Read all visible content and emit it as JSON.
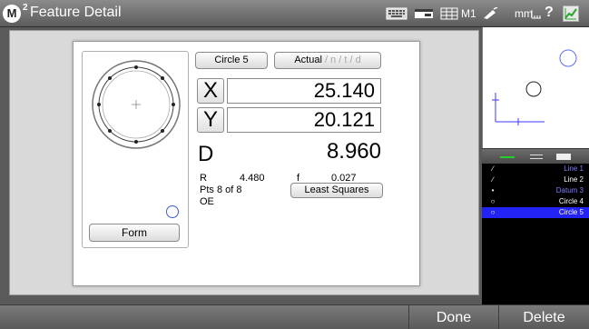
{
  "app": {
    "logo_letter": "M",
    "logo_sup": "2",
    "title": "Feature Detail"
  },
  "toolbar": {
    "icons": [
      "keyboard-icon",
      "display-icon",
      "grid-icon",
      "probe-icon",
      "ruler-icon",
      "help-icon",
      "graph-icon"
    ],
    "machine": "M1",
    "units": "mm",
    "help": "?"
  },
  "feature": {
    "name": "Circle 5",
    "mode_label": "Actual",
    "mode_suffix": " / n / t / d",
    "x_label": "X",
    "x_value": "25.140",
    "y_label": "Y",
    "y_value": "20.121",
    "d_label": "D",
    "d_value": "8.960",
    "r_label": "R",
    "r_value": "4.480",
    "f_label": "f",
    "f_value": "0.027",
    "pts_text": "Pts 8 of 8",
    "oe_text": "OE",
    "fit_method": "Least Squares",
    "form_button": "Form"
  },
  "feature_list": [
    {
      "icon": "line-icon",
      "name": "Line 1",
      "color": "#7f7fff",
      "selected": false
    },
    {
      "icon": "line-icon",
      "name": "Line 2",
      "color": "#ffffff",
      "selected": false
    },
    {
      "icon": "point-icon",
      "name": "Datum 3",
      "color": "#7f7fff",
      "selected": false
    },
    {
      "icon": "circle-icon",
      "name": "Circle 4",
      "color": "#ffffff",
      "selected": false
    },
    {
      "icon": "circle-icon",
      "name": "Circle 5",
      "color": "#ffffff",
      "selected": true
    }
  ],
  "bottom": {
    "done": "Done",
    "delete": "Delete"
  },
  "colors": {
    "accent_blue": "#2323f5",
    "preview_circle": "#5a6ee8",
    "datum_tick": "#3b3bff"
  }
}
